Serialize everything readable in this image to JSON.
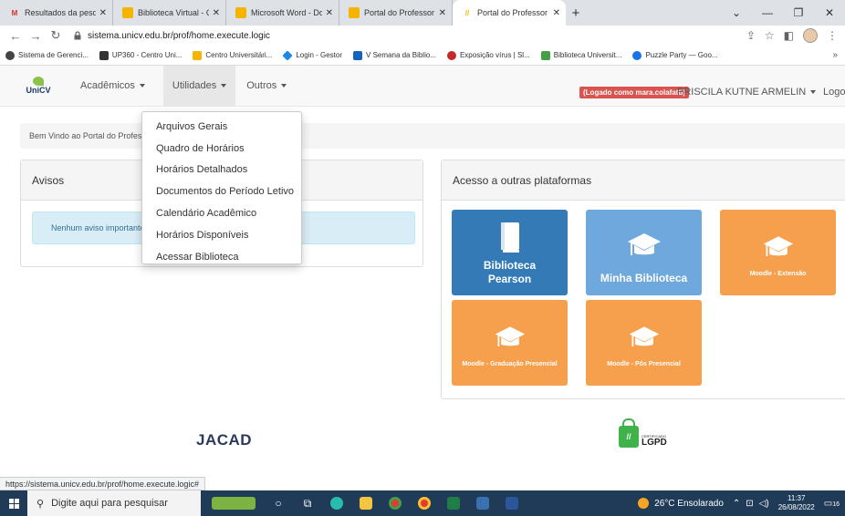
{
  "browser": {
    "tabs": [
      {
        "title": "Resultados da pesquisa - ma",
        "icon": "gmail-icon",
        "color": "#d93025",
        "active": false
      },
      {
        "title": "Biblioteca Virtual - Centro Un",
        "icon": "unicv-icon",
        "color": "#f5b400",
        "active": false
      },
      {
        "title": "Microsoft Word - Documento",
        "icon": "unicv-icon",
        "color": "#f5b400",
        "active": false
      },
      {
        "title": "Portal do Professor - Centro",
        "icon": "unicv-icon",
        "color": "#f5b400",
        "active": false
      },
      {
        "title": "Portal do Professor | SWAJAC",
        "icon": "portal-icon",
        "color": "#f5b400",
        "active": true
      }
    ],
    "url": "sistema.unicv.edu.br/prof/home.execute.logic",
    "bookmarks": [
      {
        "label": "Sistema de Gerenci...",
        "color": "#444"
      },
      {
        "label": "UP360 - Centro Uni...",
        "color": "#333"
      },
      {
        "label": "Centro Universitári...",
        "color": "#f5b400"
      },
      {
        "label": "Login - Gestor",
        "color": "#1e88e5"
      },
      {
        "label": "V Semana da Biblio...",
        "color": "#1565c0"
      },
      {
        "label": "Exposição vírus | Sl...",
        "color": "#c62828"
      },
      {
        "label": "Biblioteca Universit...",
        "color": "#43a047"
      },
      {
        "label": "Puzzle Party — Goo...",
        "color": "#1a73e8"
      }
    ],
    "status_url": "https://sistema.unicv.edu.br/prof/home.execute.logic#"
  },
  "site": {
    "logo_text": "UniCV",
    "nav": {
      "academicos": "Acadêmicos",
      "utilidades": "Utilidades",
      "outros": "Outros"
    },
    "logged_badge": "(Logado como mara.colafatti)",
    "user_name": "PRISCILA KUTNE ARMELIN",
    "logout": "Logout",
    "breadcrumb": "Bem Vindo ao Portal do Professor",
    "dropdown": [
      "Arquivos Gerais",
      "Quadro de Horários",
      "Horários Detalhados",
      "Documentos do Período Letivo",
      "Calendário Acadêmico",
      "Horários Disponíveis",
      "Acessar Biblioteca"
    ],
    "avisos": {
      "title": "Avisos",
      "alert": "Nenhum aviso importante para você."
    },
    "plataformas": {
      "title": "Acesso a outras plataformas",
      "tiles": [
        {
          "label": "Biblioteca Pearson",
          "color": "#337ab7"
        },
        {
          "label": "Minha Biblioteca",
          "color": "#6fa8dc"
        },
        {
          "label": "Moodle - Extensão",
          "color": "#f6a04d"
        },
        {
          "label": "Moodle - Graduação Presencial",
          "color": "#f6a04d"
        },
        {
          "label": "Moodle - Pós Presencial",
          "color": "#f6a04d"
        }
      ]
    },
    "footer_logo": "JACAD",
    "lgpd": {
      "small": "CERTIFICADO",
      "big": "LGPD"
    }
  },
  "taskbar": {
    "search_placeholder": "Digite aqui para pesquisar",
    "weather": "26°C Ensolarado",
    "time": "11:37",
    "date": "26/08/2022",
    "notifications": "16"
  }
}
